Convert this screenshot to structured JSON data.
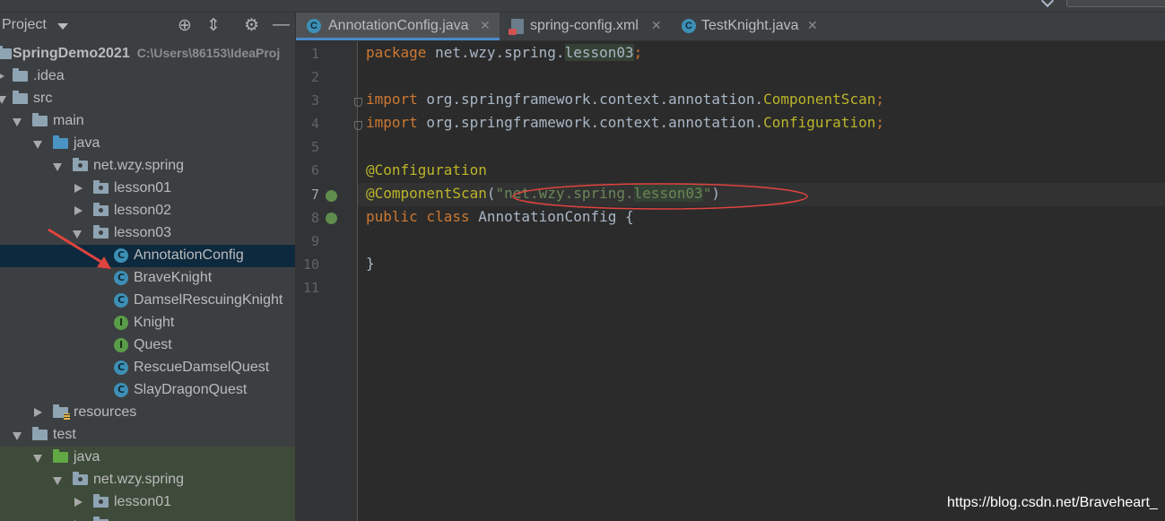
{
  "project_panel": {
    "title": "Project",
    "tree": [
      {
        "label": "SpringDemo2021",
        "path": "C:\\Users\\86153\\IdeaProj"
      },
      {
        "label": ".idea"
      },
      {
        "label": "src"
      },
      {
        "label": "main"
      },
      {
        "label": "java"
      },
      {
        "label": "net.wzy.spring"
      },
      {
        "label": "lesson01"
      },
      {
        "label": "lesson02"
      },
      {
        "label": "lesson03"
      },
      {
        "label": "AnnotationConfig"
      },
      {
        "label": "BraveKnight"
      },
      {
        "label": "DamselRescuingKnight"
      },
      {
        "label": "Knight"
      },
      {
        "label": "Quest"
      },
      {
        "label": "RescueDamselQuest"
      },
      {
        "label": "SlayDragonQuest"
      },
      {
        "label": "resources"
      },
      {
        "label": "test"
      },
      {
        "label": "java"
      },
      {
        "label": "net.wzy.spring"
      },
      {
        "label": "lesson01"
      }
    ]
  },
  "icons": {
    "class_letter": "C",
    "interface_letter": "I"
  },
  "tabs": [
    {
      "label": "AnnotationConfig.java",
      "active": true
    },
    {
      "label": "spring-config.xml"
    },
    {
      "label": "TestKnight.java"
    }
  ],
  "editor": {
    "line_numbers": [
      "1",
      "2",
      "3",
      "4",
      "5",
      "6",
      "7",
      "8",
      "9",
      "10",
      "11"
    ],
    "code": {
      "l1_kw": "package",
      "l1_a": " net.wzy.spring.",
      "l1_b": "lesson03",
      "l1_c": ";",
      "l3_kw": "import",
      "l3_a": " org.springframework.context.annotation.",
      "l3_b": "ComponentScan",
      "l3_c": ";",
      "l4_kw": "import",
      "l4_a": " org.springframework.context.annotation.",
      "l4_b": "Configuration",
      "l4_c": ";",
      "l6_ann": "@Configuration",
      "l7_ann": "@ComponentScan",
      "l7_a": "(",
      "l7_s1": "\"net.wzy.spring.",
      "l7_s2": "lesson03",
      "l7_s3": "\"",
      "l7_b": ")",
      "l8_kw1": "public",
      "l8_kw2": " class",
      "l8_a": " AnnotationConfig {",
      "l10": "}"
    }
  },
  "watermark": "https://blog.csdn.net/Braveheart_",
  "colors": {
    "keyword": "#cc7832",
    "annotation": "#bbb529",
    "string": "#6a8759",
    "selection": "#0d293e",
    "annotation_mark": "#e0443e"
  }
}
